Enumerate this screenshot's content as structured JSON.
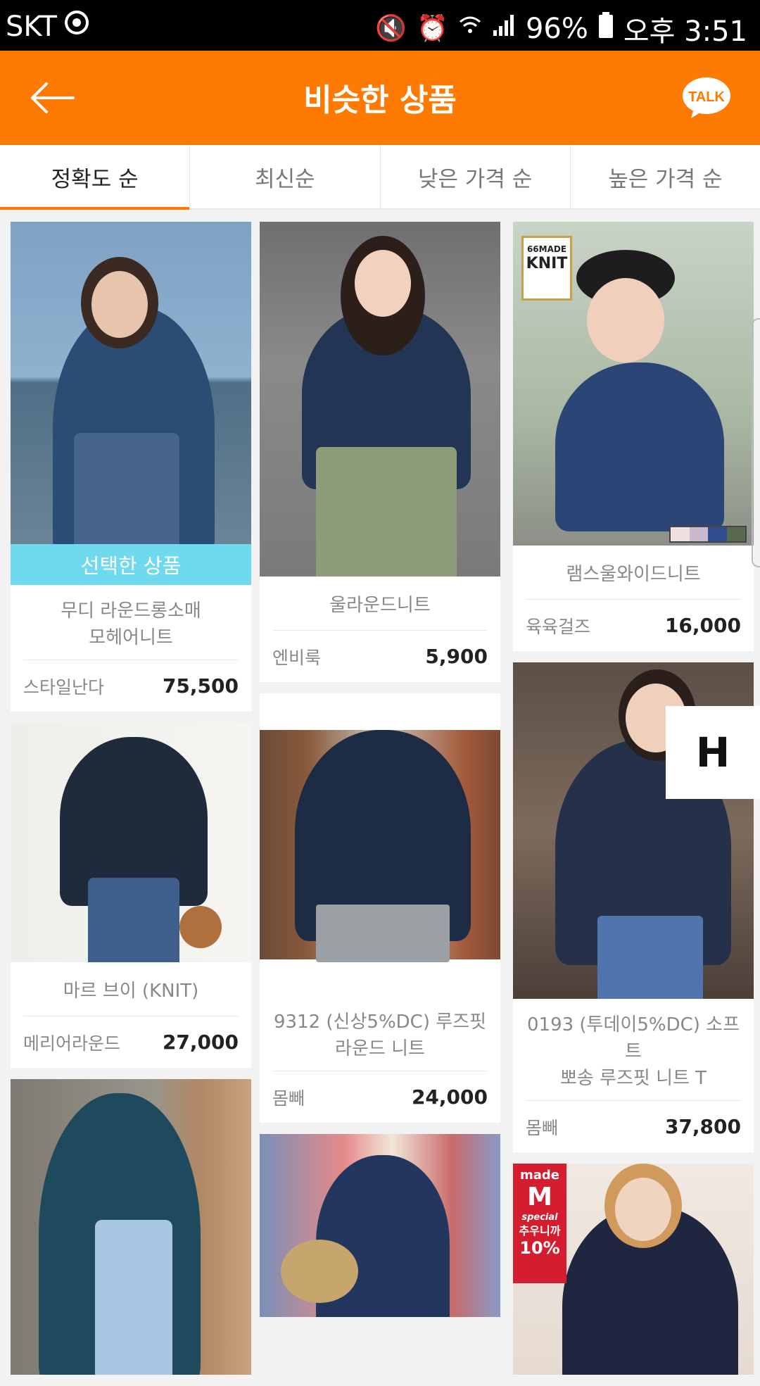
{
  "status": {
    "carrier": "SKT",
    "battery": "96%",
    "time": "오후 3:51"
  },
  "header": {
    "title": "비슷한 상품",
    "talk_label": "TALK"
  },
  "tabs": [
    {
      "label": "정확도 순"
    },
    {
      "label": "최신순"
    },
    {
      "label": "낮은 가격 순"
    },
    {
      "label": "높은 가격 순"
    }
  ],
  "selected_label": "선택한 상품",
  "side_button": "H",
  "products": {
    "c1": [
      {
        "name1": "무디 라운드롱소매",
        "name2": "모헤어니트",
        "seller": "스타일난다",
        "price": "75,500"
      },
      {
        "name1": "마르 브이 (KNIT)",
        "name2": "",
        "seller": "메리어라운드",
        "price": "27,000"
      }
    ],
    "c2": [
      {
        "name1": "울라운드니트",
        "name2": "",
        "seller": "엔비룩",
        "price": "5,900"
      },
      {
        "name1": "9312 (신상5%DC) 루즈핏",
        "name2": "라운드 니트",
        "seller": "몸빼",
        "price": "24,000"
      }
    ],
    "c3": [
      {
        "name1": "램스울와이드니트",
        "name2": "",
        "seller": "육육걸즈",
        "price": "16,000"
      },
      {
        "name1": "0193 (투데이5%DC) 소프트",
        "name2": "뽀송 루즈핏 니트 T",
        "seller": "몸빼",
        "price": "37,800"
      }
    ]
  },
  "badges": {
    "knit_top": "66MADE",
    "knit_main": "KNIT",
    "made_top": "made",
    "made_main": "M",
    "made_sub": "special",
    "made_promo1": "추우니까",
    "made_promo2": "10%"
  }
}
